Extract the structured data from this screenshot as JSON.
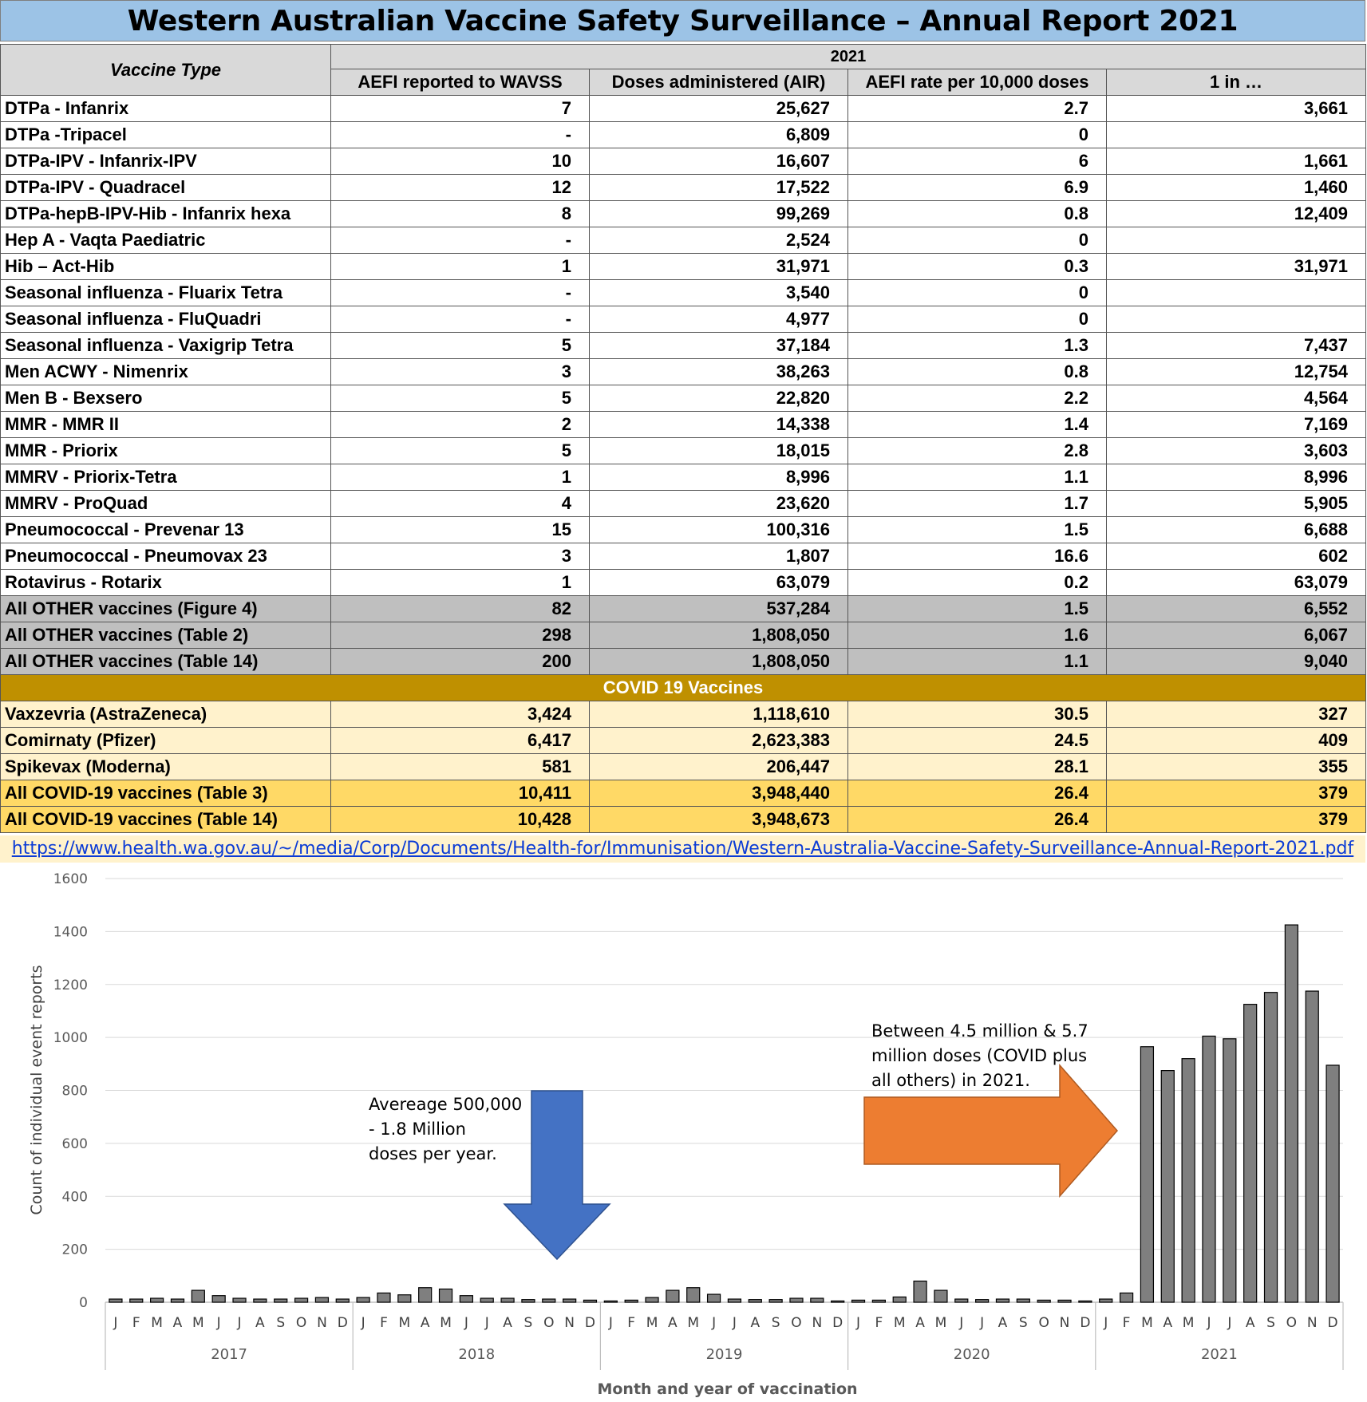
{
  "title": "Western Australian Vaccine Safety Surveillance – Annual Report 2021",
  "table": {
    "header_vaccine_type": "Vaccine Type",
    "header_year": "2021",
    "columns": [
      "AEFI reported to WAVSS",
      "Doses administered (AIR)",
      "AEFI rate per 10,000 doses",
      "1 in …"
    ],
    "rows": [
      {
        "name": "DTPa - Infanrix",
        "aefi": "7",
        "doses": "25,627",
        "rate": "2.7",
        "one_in": "3,661"
      },
      {
        "name": "DTPa -Tripacel",
        "aefi": "-",
        "doses": "6,809",
        "rate": "0",
        "one_in": ""
      },
      {
        "name": "DTPa-IPV - Infanrix-IPV",
        "aefi": "10",
        "doses": "16,607",
        "rate": "6",
        "one_in": "1,661"
      },
      {
        "name": "DTPa-IPV - Quadracel",
        "aefi": "12",
        "doses": "17,522",
        "rate": "6.9",
        "one_in": "1,460"
      },
      {
        "name": "DTPa-hepB-IPV-Hib - Infanrix hexa",
        "aefi": "8",
        "doses": "99,269",
        "rate": "0.8",
        "one_in": "12,409"
      },
      {
        "name": "Hep A - Vaqta Paediatric",
        "aefi": "-",
        "doses": "2,524",
        "rate": "0",
        "one_in": ""
      },
      {
        "name": "Hib – Act-Hib",
        "aefi": "1",
        "doses": "31,971",
        "rate": "0.3",
        "one_in": "31,971"
      },
      {
        "name": "Seasonal influenza - Fluarix Tetra",
        "aefi": "-",
        "doses": "3,540",
        "rate": "0",
        "one_in": ""
      },
      {
        "name": "Seasonal influenza - FluQuadri",
        "aefi": "-",
        "doses": "4,977",
        "rate": "0",
        "one_in": ""
      },
      {
        "name": "Seasonal influenza - Vaxigrip Tetra",
        "aefi": "5",
        "doses": "37,184",
        "rate": "1.3",
        "one_in": "7,437"
      },
      {
        "name": "Men ACWY - Nimenrix",
        "aefi": "3",
        "doses": "38,263",
        "rate": "0.8",
        "one_in": "12,754"
      },
      {
        "name": "Men B - Bexsero",
        "aefi": "5",
        "doses": "22,820",
        "rate": "2.2",
        "one_in": "4,564"
      },
      {
        "name": "MMR - MMR II",
        "aefi": "2",
        "doses": "14,338",
        "rate": "1.4",
        "one_in": "7,169"
      },
      {
        "name": "MMR - Priorix",
        "aefi": "5",
        "doses": "18,015",
        "rate": "2.8",
        "one_in": "3,603"
      },
      {
        "name": "MMRV - Priorix-Tetra",
        "aefi": "1",
        "doses": "8,996",
        "rate": "1.1",
        "one_in": "8,996"
      },
      {
        "name": "MMRV - ProQuad",
        "aefi": "4",
        "doses": "23,620",
        "rate": "1.7",
        "one_in": "5,905"
      },
      {
        "name": "Pneumococcal - Prevenar 13",
        "aefi": "15",
        "doses": "100,316",
        "rate": "1.5",
        "one_in": "6,688"
      },
      {
        "name": "Pneumococcal - Pneumovax 23",
        "aefi": "3",
        "doses": "1,807",
        "rate": "16.6",
        "one_in": "602"
      },
      {
        "name": "Rotavirus - Rotarix",
        "aefi": "1",
        "doses": "63,079",
        "rate": "0.2",
        "one_in": "63,079"
      }
    ],
    "other_totals": [
      {
        "name": "All OTHER vaccines (Figure 4)",
        "aefi": "82",
        "doses": "537,284",
        "rate": "1.5",
        "one_in": "6,552"
      },
      {
        "name": "All OTHER vaccines (Table 2)",
        "aefi": "298",
        "doses": "1,808,050",
        "rate": "1.6",
        "one_in": "6,067"
      },
      {
        "name": "All OTHER vaccines (Table 14)",
        "aefi": "200",
        "doses": "1,808,050",
        "rate": "1.1",
        "one_in": "9,040"
      }
    ],
    "covid_header": "COVID 19 Vaccines",
    "covid_rows": [
      {
        "name": "Vaxzevria (AstraZeneca)",
        "aefi": "3,424",
        "doses": "1,118,610",
        "rate": "30.5",
        "one_in": "327"
      },
      {
        "name": "Comirnaty (Pfizer)",
        "aefi": "6,417",
        "doses": "2,623,383",
        "rate": "24.5",
        "one_in": "409"
      },
      {
        "name": "Spikevax (Moderna)",
        "aefi": "581",
        "doses": "206,447",
        "rate": "28.1",
        "one_in": "355"
      }
    ],
    "covid_totals": [
      {
        "name": "All COVID-19 vaccines (Table 3)",
        "aefi": "10,411",
        "doses": "3,948,440",
        "rate": "26.4",
        "one_in": "379"
      },
      {
        "name": "All COVID-19 vaccines (Table 14)",
        "aefi": "10,428",
        "doses": "3,948,673",
        "rate": "26.4",
        "one_in": "379"
      }
    ]
  },
  "url": "https://www.health.wa.gov.au/~/media/Corp/Documents/Health-for/Immunisation/Western-Australia-Vaccine-Safety-Surveillance-Annual-Report-2021.pdf",
  "chart_data": {
    "type": "bar",
    "title": "",
    "xlabel": "Month and year of vaccination",
    "ylabel": "Count of individual event reports",
    "ylim": [
      0,
      1600
    ],
    "yticks": [
      0,
      200,
      400,
      600,
      800,
      1000,
      1200,
      1400,
      1600
    ],
    "grid": true,
    "bar_color": "#7f7f7f",
    "months": [
      "J",
      "F",
      "M",
      "A",
      "M",
      "J",
      "J",
      "A",
      "S",
      "O",
      "N",
      "D"
    ],
    "years": [
      "2017",
      "2018",
      "2019",
      "2020",
      "2021"
    ],
    "values": [
      12,
      12,
      15,
      12,
      45,
      25,
      15,
      12,
      12,
      15,
      18,
      12,
      18,
      35,
      28,
      55,
      50,
      25,
      15,
      15,
      10,
      12,
      12,
      8,
      5,
      8,
      18,
      45,
      55,
      30,
      12,
      10,
      10,
      15,
      15,
      5,
      8,
      8,
      20,
      80,
      45,
      12,
      10,
      12,
      12,
      8,
      8,
      5,
      12,
      35,
      965,
      875,
      920,
      1005,
      995,
      1125,
      1170,
      1425,
      1175,
      895
    ],
    "annotations": [
      {
        "text_lines": [
          "Avereage 500,000",
          "- 1.8 Million",
          "doses per year."
        ],
        "arrow_color": "#4472c4",
        "direction": "down"
      },
      {
        "text_lines": [
          "Between 4.5 million & 5.7",
          "million doses (COVID plus",
          "all others) in 2021."
        ],
        "arrow_color": "#ed7d31",
        "direction": "right"
      }
    ]
  }
}
